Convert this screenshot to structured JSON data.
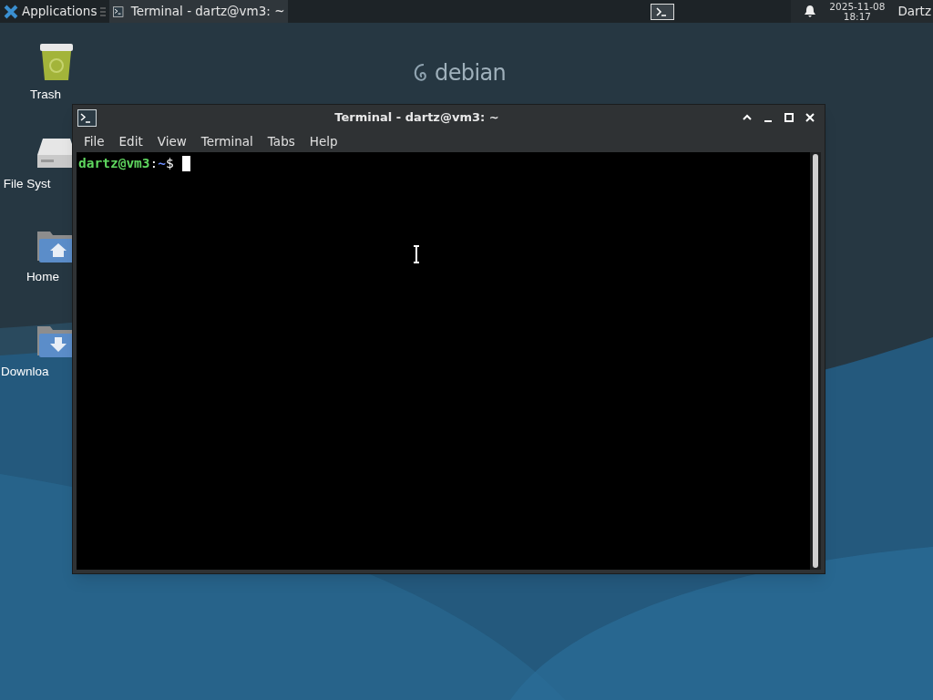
{
  "panel": {
    "menu_label": "Applications",
    "tasks": [
      {
        "label": "Terminal - dartz@vm3: ~",
        "selected": true
      }
    ],
    "clock": {
      "date": "2025-11-08",
      "time": "18:17"
    },
    "user": "Dartz"
  },
  "wallpaper": {
    "logo_text": "debian"
  },
  "desktop_icons": [
    {
      "kind": "trash",
      "label": "Trash"
    },
    {
      "kind": "drive",
      "label": "File Syst"
    },
    {
      "kind": "home",
      "label": "Home"
    },
    {
      "kind": "download",
      "label": "Downloa"
    }
  ],
  "window": {
    "title": "Terminal - dartz@vm3: ~",
    "menu": [
      "File",
      "Edit",
      "View",
      "Terminal",
      "Tabs",
      "Help"
    ],
    "prompt": {
      "user_host": "dartz@vm3",
      "separator": ":",
      "path": "~",
      "symbol": "$"
    }
  }
}
